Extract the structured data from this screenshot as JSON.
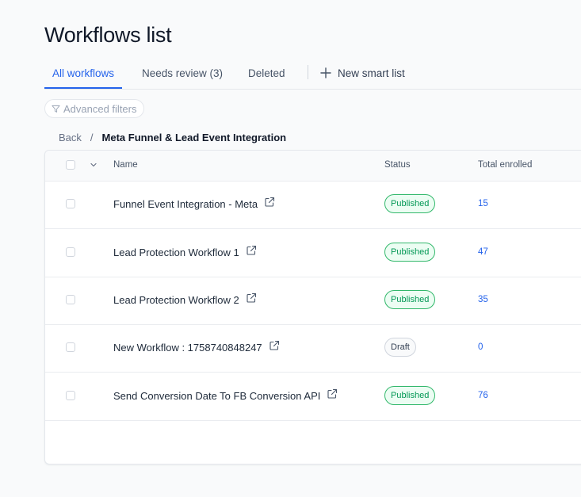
{
  "page": {
    "title": "Workflows list"
  },
  "tabs": {
    "all": "All workflows",
    "review": "Needs review (3)",
    "deleted": "Deleted",
    "new_smart_list": "New smart list"
  },
  "filters": {
    "advanced": "Advanced filters"
  },
  "breadcrumb": {
    "back": "Back",
    "separator": "/",
    "current": "Meta Funnel & Lead Event Integration"
  },
  "table": {
    "columns": {
      "name": "Name",
      "status": "Status",
      "enrolled": "Total enrolled"
    },
    "rows": [
      {
        "name": "Funnel Event Integration - Meta",
        "status": "Published",
        "enrolled": "15"
      },
      {
        "name": "Lead Protection Workflow 1",
        "status": "Published",
        "enrolled": "47"
      },
      {
        "name": "Lead Protection Workflow 2",
        "status": "Published",
        "enrolled": "35"
      },
      {
        "name": "New Workflow : 1758740848247",
        "status": "Draft",
        "enrolled": "0"
      },
      {
        "name": "Send Conversion Date To FB Conversion API",
        "status": "Published",
        "enrolled": "76"
      }
    ]
  },
  "colors": {
    "accent": "#2563eb",
    "published": "#039855",
    "draft": "#344054"
  }
}
